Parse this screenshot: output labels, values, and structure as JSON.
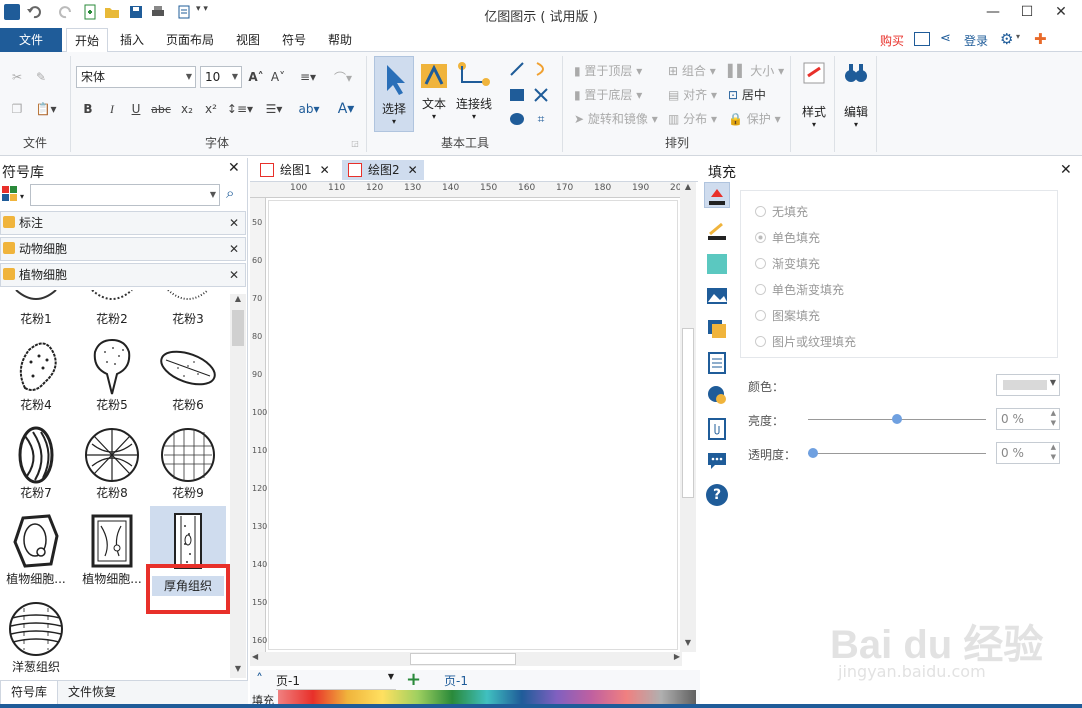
{
  "app": {
    "title": "亿图图示 ( 试用版 )"
  },
  "menu": {
    "file": "文件",
    "tabs": [
      "开始",
      "插入",
      "页面布局",
      "视图",
      "符号",
      "帮助"
    ],
    "buy": "购买",
    "login": "登录"
  },
  "ribbon": {
    "groups": {
      "file": "文件",
      "font": "字体",
      "basic_tools": "基本工具",
      "arrange": "排列"
    },
    "font_name": "宋体",
    "font_size": "10",
    "tools": {
      "select": "选择",
      "text": "文本",
      "connector": "连接线"
    },
    "arrange": {
      "bring_front": "置于顶层",
      "send_back": "置于底层",
      "rotate_mirror": "旋转和镜像",
      "group": "组合",
      "align": "对齐",
      "distribute": "分布",
      "size": "大小",
      "center": "居中",
      "protect": "保护"
    },
    "style": "样式",
    "edit": "编辑"
  },
  "left_panel": {
    "title": "符号库",
    "search_placeholder": "",
    "libraries": [
      "标注",
      "动物细胞",
      "植物细胞"
    ],
    "symbols": [
      "花粉1",
      "花粉2",
      "花粉3",
      "花粉4",
      "花粉5",
      "花粉6",
      "花粉7",
      "花粉8",
      "花粉9",
      "植物细胞...",
      "植物细胞...",
      "厚角组织",
      "洋葱组织"
    ],
    "bottom_tabs": [
      "符号库",
      "文件恢复"
    ]
  },
  "doc_tabs": [
    "绘图1",
    "绘图2"
  ],
  "ruler": {
    "top": [
      "100",
      "110",
      "120",
      "130",
      "140",
      "150",
      "160",
      "170",
      "180",
      "190",
      "20"
    ],
    "left": [
      "50",
      "60",
      "70",
      "80",
      "90",
      "100",
      "110",
      "120",
      "130",
      "140",
      "150",
      "160"
    ]
  },
  "fill_panel": {
    "title": "填充",
    "options": [
      "无填充",
      "单色填充",
      "渐变填充",
      "单色渐变填充",
      "图案填充",
      "图片或纹理填充"
    ],
    "color_label": "颜色：",
    "brightness_label": "亮度：",
    "brightness_value": "0 %",
    "transparency_label": "透明度：",
    "transparency_value": "0 %"
  },
  "status": {
    "page_select": "页-1",
    "page_tab": "页-1",
    "fill_label": "填充"
  },
  "watermark": {
    "text": "Bai du 经验",
    "url": "jingyan.baidu.com"
  },
  "colors": {
    "accent": "#1f5c99",
    "selection": "#cfdcee",
    "highlight_box": "#e8302a"
  }
}
